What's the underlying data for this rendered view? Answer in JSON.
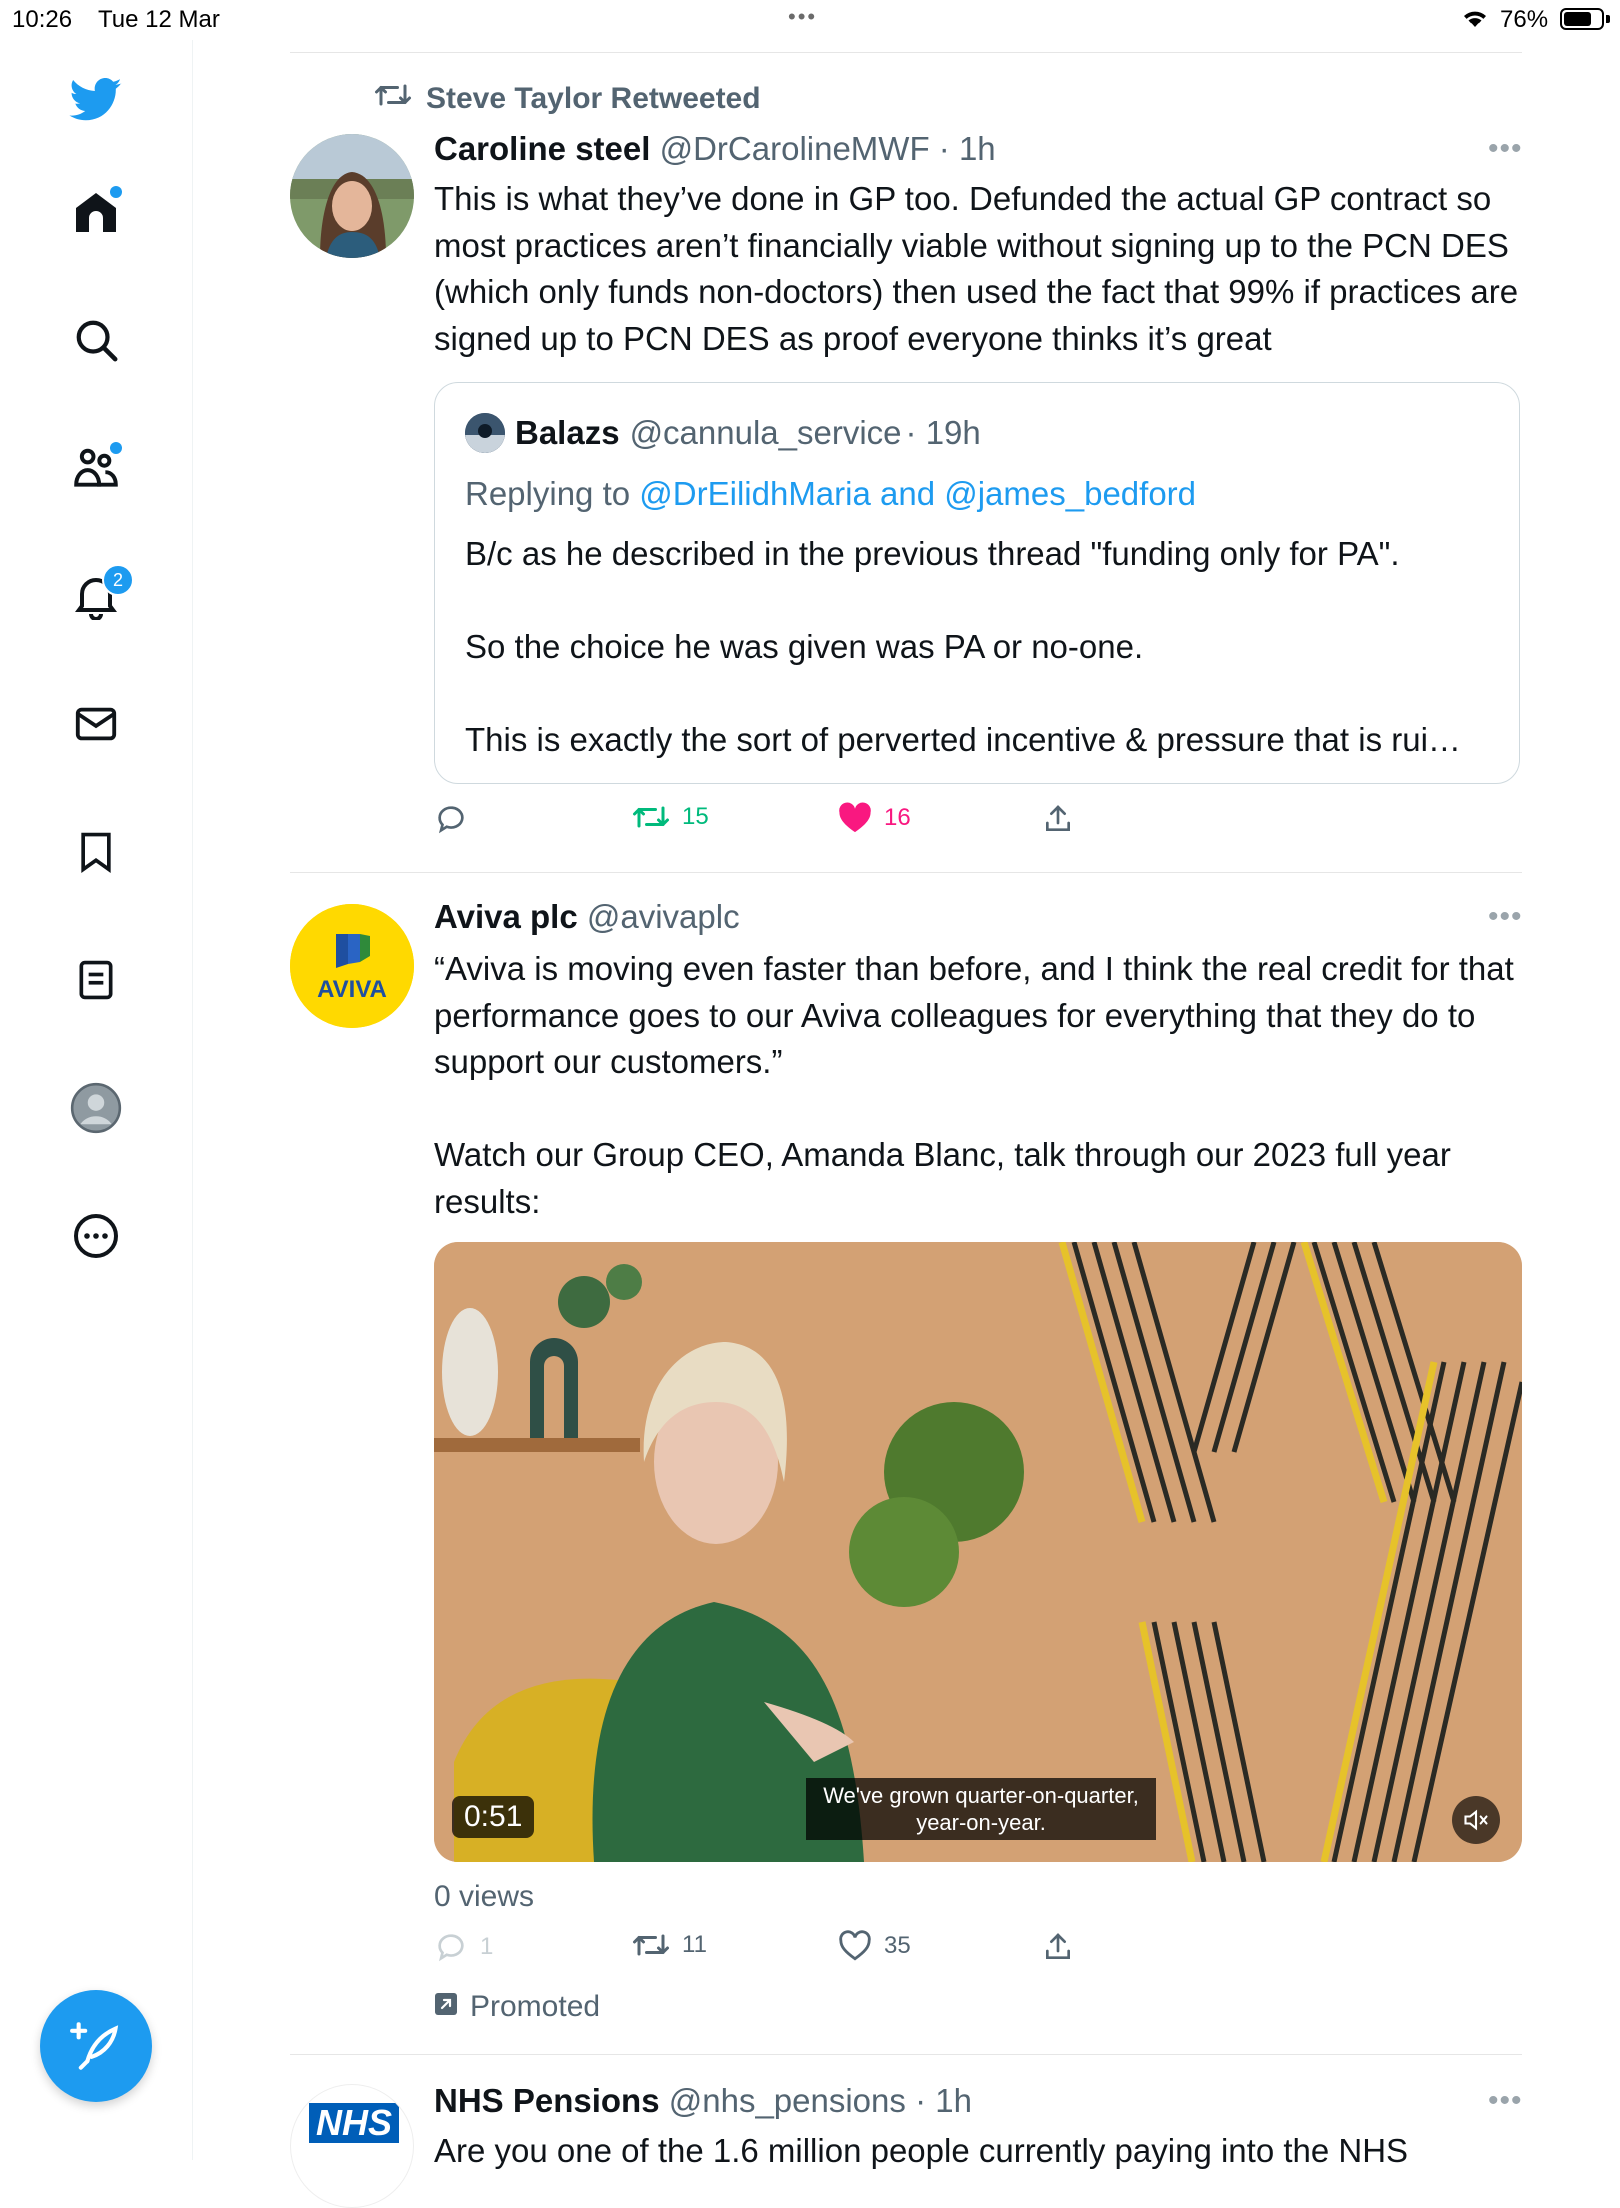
{
  "status_bar": {
    "time": "10:26",
    "date": "Tue 12 Mar",
    "battery": "76%",
    "battery_level": 0.76
  },
  "sidebar": {
    "items": [
      {
        "name": "home",
        "icon": "home-icon",
        "has_dot": true
      },
      {
        "name": "explore",
        "icon": "search-icon"
      },
      {
        "name": "communities",
        "icon": "communities-icon",
        "has_dot": true
      },
      {
        "name": "notifications",
        "icon": "bell-icon",
        "badge": "2"
      },
      {
        "name": "messages",
        "icon": "mail-icon"
      },
      {
        "name": "bookmarks",
        "icon": "bookmark-icon"
      },
      {
        "name": "lists",
        "icon": "list-icon"
      },
      {
        "name": "profile",
        "icon": "avatar-icon"
      },
      {
        "name": "more",
        "icon": "more-circle-icon"
      }
    ],
    "compose_icon": "feather-plus-icon",
    "accent": "#1d9bf0"
  },
  "tweets": [
    {
      "retweeted_by": "Steve Taylor Retweeted",
      "name": "Caroline steel",
      "handle": "@DrCarolineMWF",
      "time": "· 1h",
      "text": "This is what they’ve done in GP too. Defunded the actual GP contract so most practices aren’t financially viable without signing up to the PCN DES (which only funds non-doctors) then used the fact that 99% if practices are signed up to PCN DES as proof everyone thinks it’s great",
      "quote": {
        "name": "Balazs",
        "handle": "@cannula_service",
        "time": "· 19h",
        "replying_prefix": "Replying to",
        "replying_to": "@DrEilidhMaria and @james_bedford",
        "text": "B/c as he described in the previous thread \"funding only for PA\".\n\nSo the choice he was given was PA or no-one.\n\nThis is exactly the sort of perverted incentive & pressure that is rui…"
      },
      "actions": {
        "replies": "",
        "retweets": "15",
        "likes": "16",
        "liked": true,
        "retweeted_color": "#00ba7c",
        "like_color": "#f91880"
      }
    },
    {
      "name": "Aviva plc",
      "handle": "@avivaplc",
      "text": "“Aviva is moving even faster than before, and I think the real credit for that performance goes to our Aviva colleagues for everything that they do to support our customers.”\n\nWatch our Group CEO, Amanda Blanc, talk through our 2023 full year results:",
      "avatar_text": "AVIVA",
      "video": {
        "duration": "0:51",
        "caption": "We've grown quarter-on-quarter, year-on-year."
      },
      "views": "0 views",
      "actions": {
        "replies": "1",
        "retweets": "11",
        "likes": "35"
      },
      "promoted": "Promoted"
    },
    {
      "name": "NHS Pensions",
      "handle": "@nhs_pensions",
      "time": "· 1h",
      "avatar_text": "NHS",
      "text": "Are you one of the 1.6 million people currently paying into the NHS"
    }
  ]
}
